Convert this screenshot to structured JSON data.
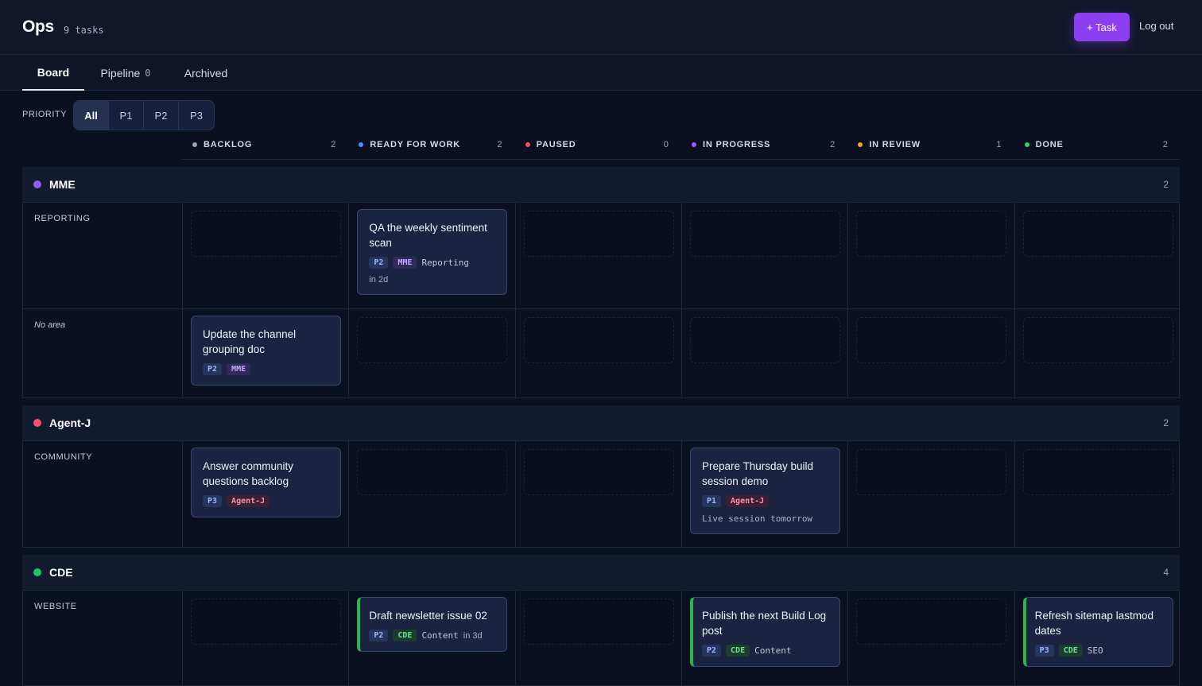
{
  "header": {
    "brand": "Ops",
    "task_count": "9 tasks",
    "add_button": "+ Task",
    "logout": "Log out"
  },
  "tabs": [
    {
      "label": "Board",
      "count": ""
    },
    {
      "label": "Pipeline",
      "count": "0"
    },
    {
      "label": "Archived",
      "count": ""
    }
  ],
  "filter": {
    "label": "PRIORITY",
    "options": [
      "All",
      "P1",
      "P2",
      "P3"
    ],
    "selected": "All"
  },
  "columns": [
    {
      "label": "BACKLOG",
      "count": "2",
      "color": "#9aa3ba"
    },
    {
      "label": "READY FOR WORK",
      "count": "2",
      "color": "#4a8cff"
    },
    {
      "label": "PAUSED",
      "count": "0",
      "color": "#ff4d5e"
    },
    {
      "label": "IN PROGRESS",
      "count": "2",
      "color": "#9b5cff"
    },
    {
      "label": "IN REVIEW",
      "count": "1",
      "color": "#f2a516"
    },
    {
      "label": "DONE",
      "count": "2",
      "color": "#2bd46a"
    }
  ],
  "groups": [
    {
      "name": "MME",
      "count": "2",
      "color": "#8b5cf6",
      "rows": [
        {
          "label": "REPORTING",
          "cards": {
            "1": {
              "title": "QA the weekly sentiment scan",
              "priority": "P2",
              "tag": "MME",
              "area": "Reporting",
              "due": "in 2d"
            }
          }
        },
        {
          "label": "No area",
          "cards": {
            "0": {
              "title": "Update the channel grouping doc",
              "priority": "P2",
              "tag": "MME"
            }
          }
        }
      ]
    },
    {
      "name": "Agent-J",
      "count": "2",
      "color": "#ff4d6d",
      "rows": [
        {
          "label": "COMMUNITY",
          "cards": {
            "0": {
              "title": "Answer community questions backlog",
              "priority": "P3",
              "tag": "Agent-J"
            },
            "3": {
              "title": "Prepare Thursday build session demo",
              "priority": "P1",
              "tag": "Agent-J",
              "note": "Live session tomorrow"
            }
          }
        }
      ]
    },
    {
      "name": "CDE",
      "count": "4",
      "color": "#22c55e",
      "rows": [
        {
          "label": "WEBSITE",
          "cards": {
            "1": {
              "title": "Draft newsletter issue 02",
              "priority": "P2",
              "tag": "CDE",
              "area": "Content",
              "due": "in 3d"
            },
            "3": {
              "title": "Publish the next Build Log post",
              "priority": "P2",
              "tag": "CDE",
              "area": "Content"
            },
            "5": {
              "title": "Refresh sitemap lastmod dates",
              "priority": "P3",
              "tag": "CDE",
              "area": "SEO"
            }
          }
        }
      ]
    }
  ]
}
